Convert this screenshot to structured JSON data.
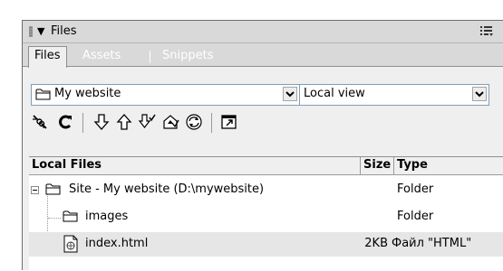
{
  "panel": {
    "title": "Files",
    "collapse_glyph": "▼",
    "options_icon": "options-menu-icon"
  },
  "tabs": [
    {
      "label": "Files",
      "active": true
    },
    {
      "label": "Assets",
      "active": false
    },
    {
      "label": "Snippets",
      "active": false
    }
  ],
  "site_select": {
    "value": "My website",
    "icon": "folder-icon"
  },
  "view_select": {
    "value": "Local view"
  },
  "toolbar": {
    "buttons": [
      "connect-icon",
      "refresh-icon",
      "get-icon",
      "put-icon",
      "check-out-icon",
      "check-in-icon",
      "synchronize-icon",
      "expand-icon"
    ]
  },
  "file_list": {
    "columns": [
      "Local Files",
      "Size",
      "Type"
    ],
    "rows": [
      {
        "name": "Site - My website (D:\\mywebsite)",
        "size": "",
        "type": "Folder",
        "icon": "folder-icon",
        "selected": false
      },
      {
        "name": "images",
        "size": "",
        "type": "Folder",
        "icon": "folder-icon",
        "selected": false
      },
      {
        "name": "index.html",
        "size": "2KB",
        "type": "Файл \"HTML\"",
        "icon": "html-file-icon",
        "selected": true
      }
    ]
  },
  "colors": {
    "panel_bg": "#efefef",
    "title_bg": "#d9d9d9",
    "selected_row": "#e6e6e6",
    "select_border": "#7f9db9"
  }
}
